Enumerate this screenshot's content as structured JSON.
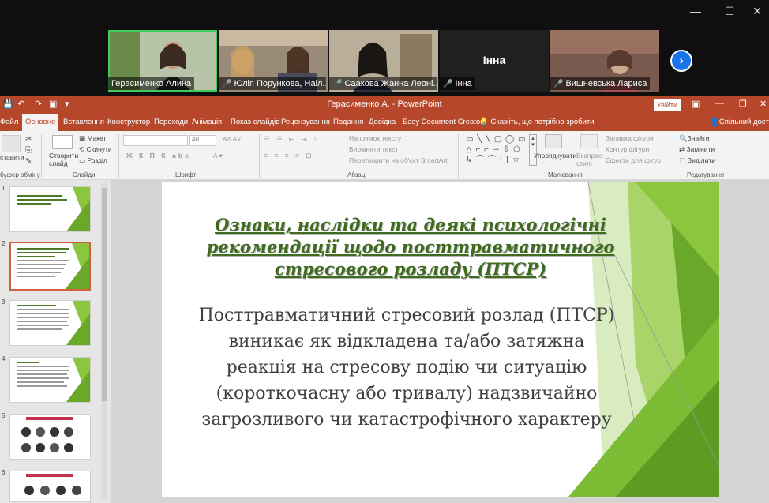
{
  "zoom": {
    "participants": [
      {
        "name": "Герасименко Алина",
        "muted": false,
        "active": true,
        "bg": "#5a6a4a"
      },
      {
        "name": "Юлія Порункова, Наіл...",
        "muted": true,
        "active": false,
        "bg": "#7a6a58"
      },
      {
        "name": "Саакова Жанна Леоні...",
        "muted": true,
        "active": false,
        "bg": "#8a8478"
      },
      {
        "name": "Інна",
        "muted": true,
        "active": false,
        "bg": "#222222",
        "center_label": "Інна"
      },
      {
        "name": "Вишневська Лариса",
        "muted": true,
        "active": false,
        "bg": "#6a4a44"
      }
    ],
    "window_controls": [
      "—",
      "☐",
      "✕"
    ],
    "next_icon": "›"
  },
  "ppt": {
    "window_title": "Герасименко А.  -  PowerPoint",
    "signin_label": "Увійти",
    "tabs": [
      "Файл",
      "Основне",
      "Вставлення",
      "Конструктор",
      "Переходи",
      "Анімація",
      "Показ слайдів",
      "Рецензування",
      "Подання",
      "Довідка",
      "Easy Document Creator"
    ],
    "selected_tab": "Основне",
    "tell_me": "Скажіть, що потрібно зробити",
    "share": "Спільний доступ",
    "ribbon": {
      "paste": "ставити",
      "new_slide": "Створити\nслайд",
      "layout": "Макет",
      "reset": "Скинути",
      "section": "Розділ",
      "font_size": "40",
      "text_direction": "Напрямок тексту",
      "align_text": "Вирівняти текст",
      "convert_smartart": "Перетворити на об'єкт SmartArt",
      "arrange": "Упорядкувати",
      "quick_styles": "Експрес-\nстилі",
      "shape_fill": "Заливка фігури",
      "shape_outline": "Контур фігури",
      "shape_effects": "Ефекти для фігур",
      "find": "Знайти",
      "replace": "Замінити",
      "select": "Виділити",
      "groups": [
        "буфер обміну",
        "Слайди",
        "Шрифт",
        "Абзац",
        "Малювання",
        "Редагування"
      ]
    },
    "thumbnails": [
      "1",
      "2",
      "3",
      "4",
      "5",
      "6"
    ],
    "selected_thumbnail": "2",
    "slide": {
      "title": "Ознаки, наслідки та деякі психологічні рекомендації щодо посттравматичного стресового розладу (ПТСР)",
      "body": "Посттравматичний стресовий розлад (ПТСР) виникає як відкладена та/або затяжна реакція на стресову подію чи ситуацію (короткочасну або тривалу) надзвичайно загрозливого чи катастрофічного характеру"
    },
    "colors": {
      "accent": "#b7472a",
      "green_dark": "#3f6b1f",
      "green_light": "#8cc63f"
    }
  }
}
